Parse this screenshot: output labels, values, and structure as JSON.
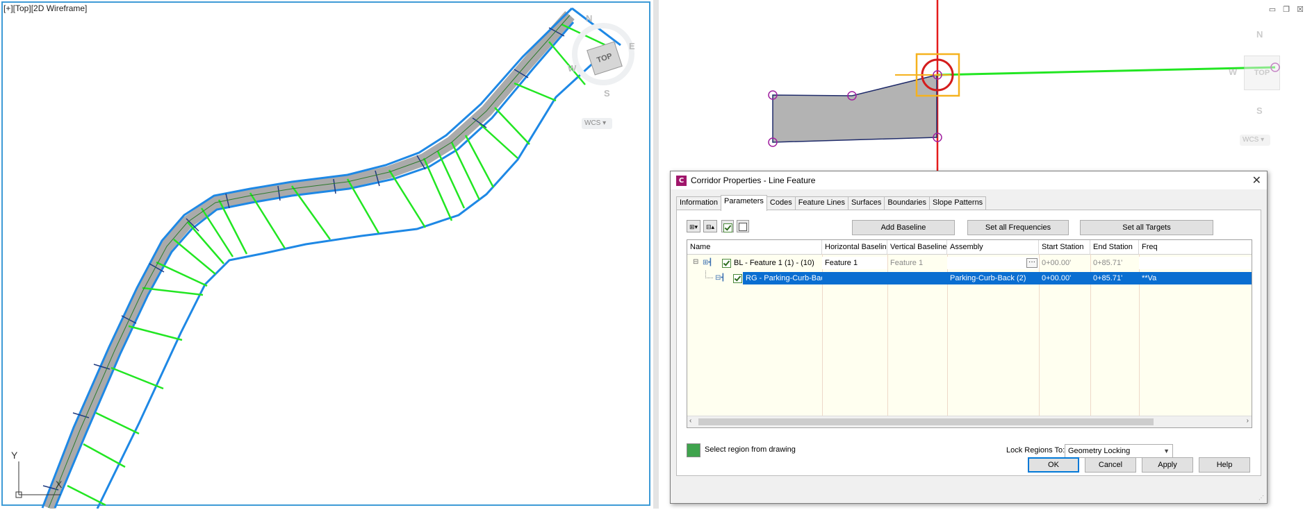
{
  "left_viewport": {
    "label": "[+][Top][2D Wireframe]"
  },
  "viewcube_left": {
    "top": "TOP",
    "n": "N",
    "e": "E",
    "s": "S",
    "w": "W",
    "wcs": "WCS"
  },
  "viewcube_right": {
    "top": "TOP",
    "n": "N",
    "e": "E",
    "s": "S",
    "w": "W",
    "wcs": "WCS"
  },
  "ucs": {
    "y": "Y",
    "x": "X"
  },
  "dialog": {
    "icon": "C",
    "title": "Corridor Properties - Line Feature",
    "close": "✕",
    "tabs": [
      "Information",
      "Parameters",
      "Codes",
      "Feature Lines",
      "Surfaces",
      "Boundaries",
      "Slope Patterns"
    ],
    "active_tab": "Parameters",
    "buttons": {
      "add_baseline": "Add Baseline",
      "set_freq": "Set all Frequencies",
      "set_targets": "Set all Targets"
    },
    "columns": [
      "Name",
      "Horizontal Baseline",
      "Vertical Baseline",
      "Assembly",
      "Start Station",
      "End Station",
      "Freq"
    ],
    "rows": [
      {
        "expand": "⊟",
        "name": "BL - Feature 1 (1) - (10)",
        "horizontal": "Feature 1",
        "vertical": "Feature 1",
        "assembly": "",
        "start": "0+00.00'",
        "end": "0+85.71'",
        "freq": ""
      },
      {
        "name": "RG - Parking-Curb-Bac...",
        "horizontal": "",
        "vertical": "",
        "assembly": "Parking-Curb-Back (2)",
        "start": "0+00.00'",
        "end": "0+85.71'",
        "freq": "**Va"
      }
    ],
    "select_region": "Select region from drawing",
    "lock_label": "Lock Regions To:",
    "lock_value": "Geometry Locking",
    "ok": "OK",
    "cancel": "Cancel",
    "apply": "Apply",
    "help": "Help",
    "ellipsis": "···"
  },
  "colors": {
    "accent": "#3d9ad6",
    "selection": "#0a6ed1",
    "frequency_lines": "#22e622",
    "alignment": "#1e88e5"
  }
}
